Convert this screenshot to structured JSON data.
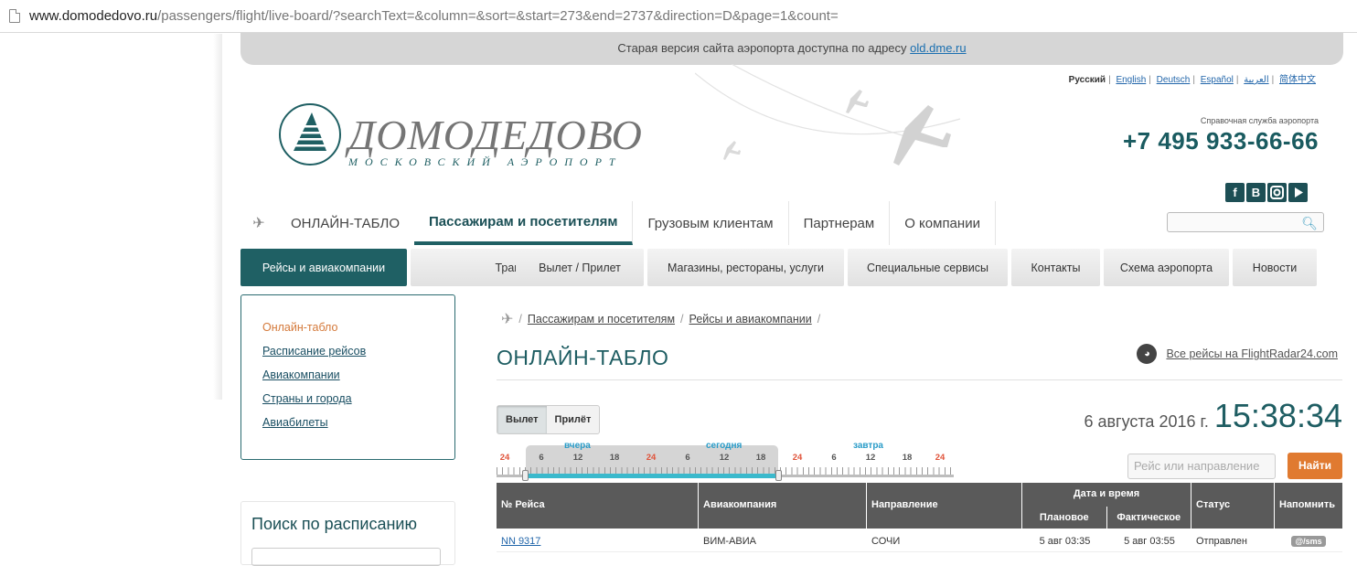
{
  "browser": {
    "url_host": "www.domodedovo.ru",
    "url_path": "/passengers/flight/live-board/?searchText=&column=&sort=&start=273&end=2737&direction=D&page=1&count="
  },
  "notice": {
    "text": "Старая версия сайта аэропорта доступна по адресу",
    "link": "old.dme.ru"
  },
  "languages": [
    "Русский",
    "English",
    "Deutsch",
    "Español",
    "العربية",
    "简体中文"
  ],
  "logo": {
    "title": "ДОМОДЕДОВО",
    "subtitle": "МОСКОВСКИЙ АЭРОПОРТ"
  },
  "contact": {
    "label": "Справочная служба аэропорта",
    "phone": "+7 495 933-66-66"
  },
  "social_icons": [
    "facebook-icon",
    "vk-icon",
    "instagram-icon",
    "youtube-icon"
  ],
  "main_nav": [
    "ОНЛАЙН-ТАБЛО",
    "Пассажирам и посетителям",
    "Грузовым клиентам",
    "Партнерам",
    "О компании"
  ],
  "sub_nav": [
    "Рейсы и авиакомпании",
    "Транспорт",
    "Вылет / Прилет",
    "Магазины, рестораны, услуги",
    "Специальные сервисы",
    "Контакты",
    "Схема аэропорта",
    "Новости"
  ],
  "sidebar": [
    "Онлайн-табло",
    "Расписание рейсов",
    "Авиакомпании",
    "Страны и города",
    "Авиабилеты"
  ],
  "schedule_search": {
    "title": "Поиск по расписанию"
  },
  "breadcrumb": [
    "Пассажирам и посетителям",
    "Рейсы и авиакомпании"
  ],
  "page_title": "ОНЛАЙН-ТАБЛО",
  "flightradar_link": "Все рейсы на FlightRadar24.com",
  "direction_toggle": [
    "Вылет",
    "Прилёт"
  ],
  "date": "6 августа 2016 г.",
  "time": "15:38:34",
  "timeline": {
    "days": [
      "вчера",
      "сегодня",
      "завтра"
    ],
    "hours": [
      "24",
      "6",
      "12",
      "18",
      "24",
      "6",
      "12",
      "18",
      "24",
      "6",
      "12",
      "18",
      "24"
    ]
  },
  "search": {
    "placeholder": "Рейс или направление",
    "button": "Найти"
  },
  "table": {
    "headers": {
      "flight": "№ Рейса",
      "airline": "Авиакомпания",
      "direction": "Направление",
      "datetime": "Дата и время",
      "planned": "Плановое",
      "actual": "Фактическое",
      "status": "Статус",
      "remind": "Напомнить"
    },
    "rows": [
      {
        "flight": "NN 9317",
        "airline": "ВИМ-АВИА",
        "direction": "СОЧИ",
        "planned": "5 авг 03:35",
        "actual": "5 авг 03:55",
        "status": "Отправлен",
        "remind": "@/sms"
      }
    ]
  }
}
